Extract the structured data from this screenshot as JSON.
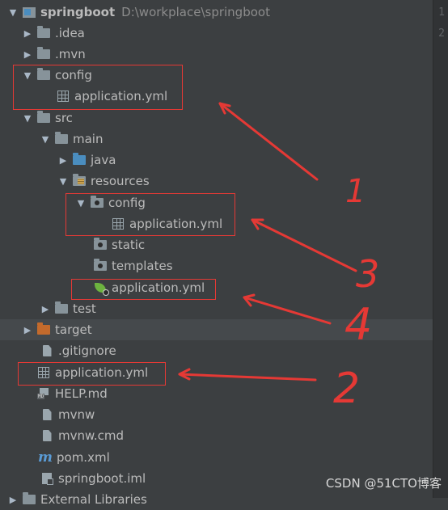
{
  "project": {
    "name": "springboot",
    "path": "D:\\workplace\\springboot"
  },
  "tree": {
    "idea": ".idea",
    "mvn": ".mvn",
    "config": "config",
    "config_yml": "application.yml",
    "src": "src",
    "main": "main",
    "java": "java",
    "resources": "resources",
    "res_config": "config",
    "res_config_yml": "application.yml",
    "static": "static",
    "templates": "templates",
    "res_yml": "application.yml",
    "test": "test",
    "target": "target",
    "gitignore": ".gitignore",
    "root_yml": "application.yml",
    "help": "HELP.md",
    "mvnw": "mvnw",
    "mvnw_cmd": "mvnw.cmd",
    "pom": "pom.xml",
    "iml": "springboot.iml",
    "external": "External Libraries"
  },
  "icons": {
    "md_tag": "MD",
    "maven": "m"
  },
  "gutter": [
    "1",
    "2"
  ],
  "annotations": {
    "n1": "1",
    "n2": "2",
    "n3": "3",
    "n4": "4",
    "color": "#e53935"
  },
  "watermark": "CSDN @51CTO博客"
}
